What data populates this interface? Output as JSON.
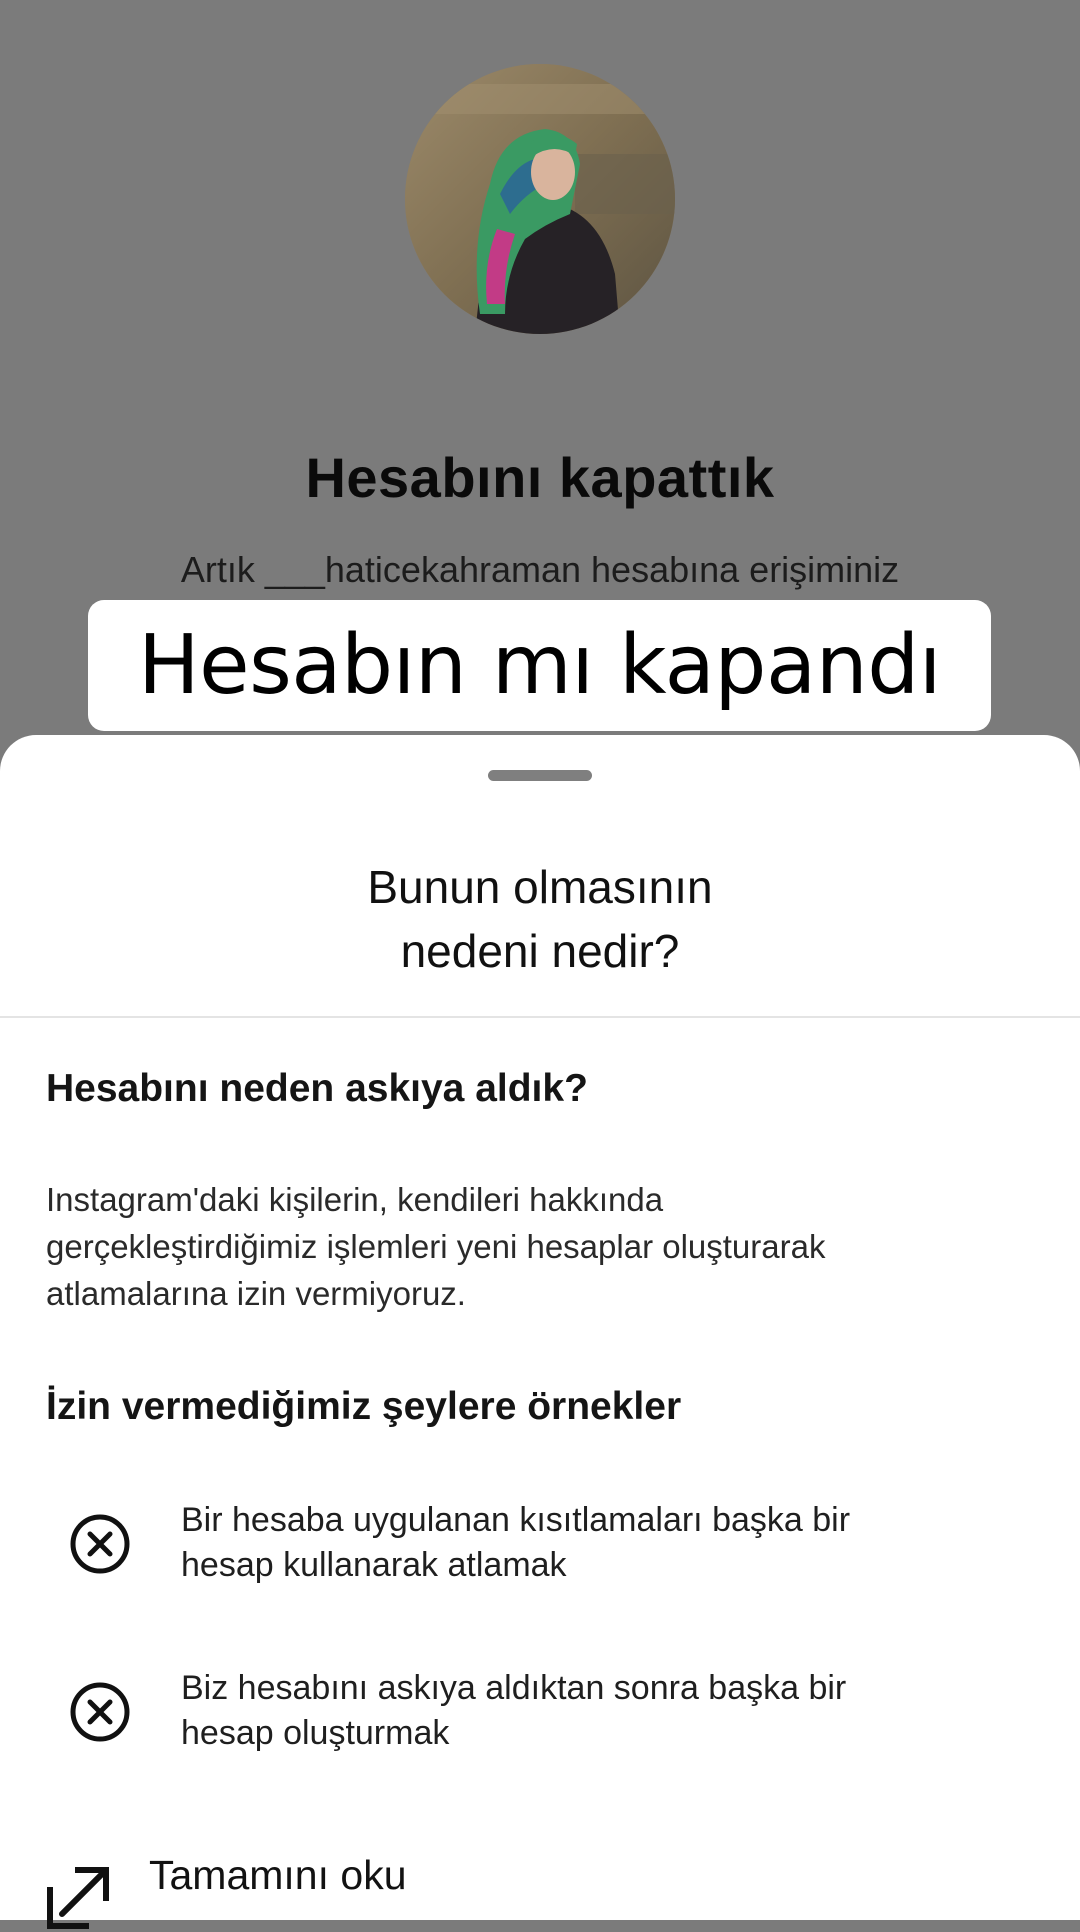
{
  "background": {
    "title": "Hesabını kapattık",
    "subtitle": "Artık ___haticekahraman hesabına erişiminiz"
  },
  "overlay_caption": "Hesabın mı kapandı",
  "sheet": {
    "title_line1": "Bunun olmasının",
    "title_line2": "nedeni nedir?",
    "section1_heading": "Hesabını neden askıya aldık?",
    "section1_body": [
      "Instagram'daki kişilerin, kendileri hakkında",
      "gerçekleştirdiğimiz işlemleri yeni hesaplar oluşturarak",
      "atlamalarına izin vermiyoruz."
    ],
    "section2_heading": "İzin vermediğimiz şeylere örnekler",
    "examples": [
      {
        "icon": "circle-x-icon",
        "lines": [
          "Bir hesaba uygulanan kısıtlamaları başka bir",
          "hesap kullanarak atlamak"
        ]
      },
      {
        "icon": "circle-x-icon",
        "lines": [
          "Biz hesabını askıya aldıktan sonra başka bir",
          "hesap oluşturmak"
        ]
      }
    ],
    "read_more": {
      "icon": "external-link-icon",
      "label": "Tamamını oku"
    }
  },
  "colors": {
    "dim_background": "#7b7b7b",
    "sheet_background": "#ffffff",
    "text_primary": "#111111",
    "divider": "#e4e4e4"
  }
}
